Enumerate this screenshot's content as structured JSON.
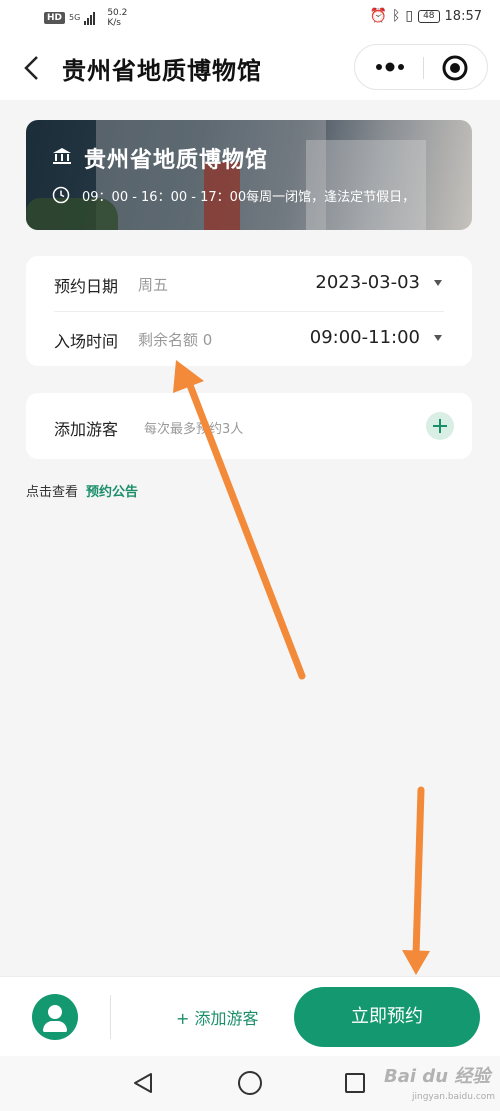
{
  "status_bar": {
    "hd": "HD",
    "signal": "5G",
    "net_speed_value": "50.2",
    "net_speed_unit": "K/s",
    "battery": "48",
    "time": "18:57"
  },
  "nav": {
    "title": "贵州省地质博物馆"
  },
  "banner": {
    "title": "贵州省地质博物馆",
    "hours": "09：00 - 16：00 - 17：00每周一闭馆，逢法定节假日，"
  },
  "form": {
    "date_label": "预约日期",
    "date_hint": "周五",
    "date_value": "2023-03-03",
    "time_label": "入场时间",
    "time_hint": "剩余名额 0",
    "time_value": "09:00-11:00"
  },
  "visitor": {
    "label": "添加游客",
    "hint": "每次最多预约3人"
  },
  "notice": {
    "prefix": "点击查看",
    "link": "预约公告"
  },
  "bottom": {
    "add_visitor": "+ 添加游客",
    "submit": "立即预约"
  },
  "watermark": {
    "brand": "Bai du 经验",
    "url": "jingyan.baidu.com"
  },
  "colors": {
    "accent": "#13986f",
    "annotation_arrow": "#f28a3a"
  }
}
